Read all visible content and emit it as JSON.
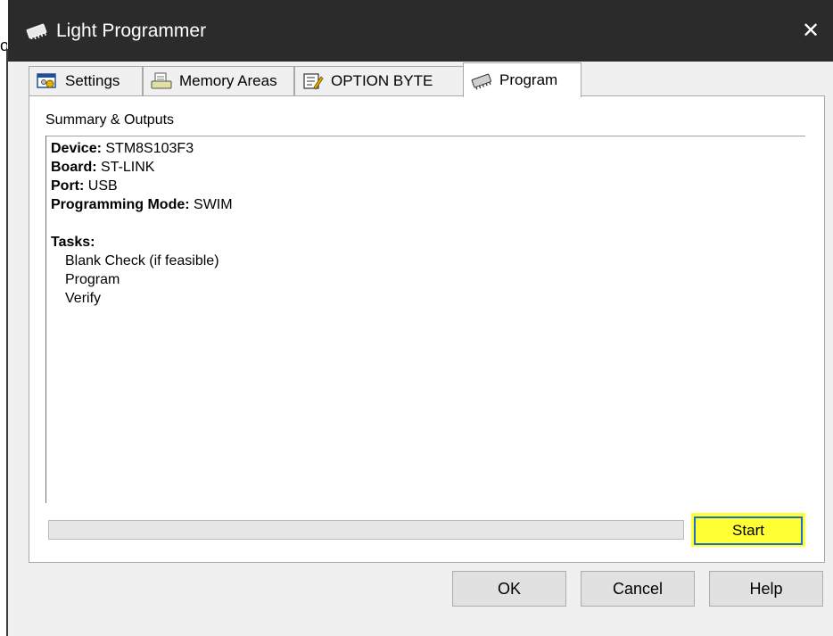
{
  "window": {
    "title": "Light Programmer",
    "close_glyph": "✕"
  },
  "left_edge": {
    "glyph": "o"
  },
  "tabs": [
    {
      "label": "Settings",
      "icon": "settings-icon",
      "active": false
    },
    {
      "label": "Memory Areas",
      "icon": "memory-areas-icon",
      "active": false
    },
    {
      "label": "OPTION BYTE",
      "icon": "option-byte-icon",
      "active": false
    },
    {
      "label": "Program",
      "icon": "chip-icon",
      "active": true
    }
  ],
  "summary": {
    "label": "Summary & Outputs",
    "device_label": "Device:",
    "device_value": "STM8S103F3",
    "board_label": "Board:",
    "board_value": "ST-LINK",
    "port_label": "Port:",
    "port_value": "USB",
    "mode_label": "Programming Mode:",
    "mode_value": "SWIM",
    "tasks_label": "Tasks:",
    "tasks": [
      "Blank Check (if feasible)",
      "Program",
      "Verify"
    ]
  },
  "progress": {
    "value": 0
  },
  "buttons": {
    "start": "Start",
    "ok": "OK",
    "cancel": "Cancel",
    "help": "Help"
  },
  "colors": {
    "titlebar": "#2b2b2b",
    "highlight": "#ffff33",
    "focus_border": "#1a6fc9"
  }
}
